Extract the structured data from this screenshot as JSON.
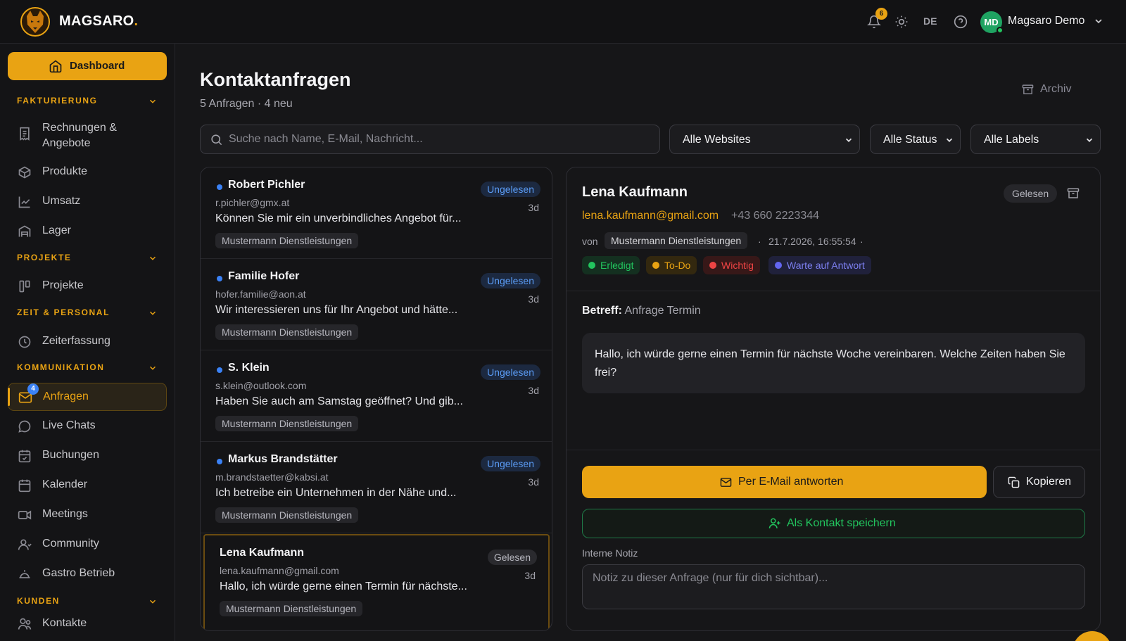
{
  "colors": {
    "accent": "#e9a313",
    "unread": "#3b82f6",
    "success": "#22c55e",
    "background": "#161618"
  },
  "header": {
    "brand": "MAGSARO",
    "brand_dot": ".",
    "notifications_count": "6",
    "language": "DE",
    "avatar_initials": "MD",
    "user_name": "Magsaro Demo"
  },
  "sidebar": {
    "dashboard": "Dashboard",
    "sections": {
      "fakturierung": "FAKTURIERUNG",
      "projekte": "PROJEKTE",
      "zeit": "ZEIT & PERSONAL",
      "kommunikation": "KOMMUNIKATION",
      "kunden": "KUNDEN"
    },
    "items": {
      "rechnungen": "Rechnungen & Angebote",
      "produkte": "Produkte",
      "umsatz": "Umsatz",
      "lager": "Lager",
      "projekte": "Projekte",
      "zeiterfassung": "Zeiterfassung",
      "anfragen": "Anfragen",
      "anfragen_badge": "4",
      "live_chats": "Live Chats",
      "buchungen": "Buchungen",
      "kalender": "Kalender",
      "meetings": "Meetings",
      "community": "Community",
      "gastro": "Gastro Betrieb",
      "kontakte": "Kontakte"
    }
  },
  "main": {
    "title": "Kontaktanfragen",
    "subtitle": "5 Anfragen · 4 neu",
    "archive": "Archiv",
    "search_placeholder": "Suche nach Name, E-Mail, Nachricht...",
    "filters": {
      "websites": "Alle Websites",
      "status": "Alle Status",
      "labels": "Alle Labels"
    }
  },
  "list": [
    {
      "name": "Robert Pichler",
      "email": "r.pichler@gmx.at",
      "message": "Können Sie mir ein unverbindliches Angebot für...",
      "site": "Mustermann Dienstleistungen",
      "status": "Ungelesen",
      "age": "3d"
    },
    {
      "name": "Familie Hofer",
      "email": "hofer.familie@aon.at",
      "message": "Wir interessieren uns für Ihr Angebot und hätte...",
      "site": "Mustermann Dienstleistungen",
      "status": "Ungelesen",
      "age": "3d"
    },
    {
      "name": "S. Klein",
      "email": "s.klein@outlook.com",
      "message": "Haben Sie auch am Samstag geöffnet? Und gib...",
      "site": "Mustermann Dienstleistungen",
      "status": "Ungelesen",
      "age": "3d"
    },
    {
      "name": "Markus Brandstätter",
      "email": "m.brandstaetter@kabsi.at",
      "message": "Ich betreibe ein Unternehmen in der Nähe und...",
      "site": "Mustermann Dienstleistungen",
      "status": "Ungelesen",
      "age": "3d"
    },
    {
      "name": "Lena Kaufmann",
      "email": "lena.kaufmann@gmail.com",
      "message": "Hallo, ich würde gerne einen Termin für nächste...",
      "site": "Mustermann Dienstleistungen",
      "status": "Gelesen",
      "age": "3d"
    }
  ],
  "detail": {
    "name": "Lena Kaufmann",
    "status": "Gelesen",
    "email": "lena.kaufmann@gmail.com",
    "phone": "+43 660 2223344",
    "from_label": "von",
    "site": "Mustermann Dienstleistungen",
    "separator": "·",
    "date": "21.7.2026, 16:55:54",
    "labels": [
      {
        "text": "Erledigt",
        "color": "#22c55e"
      },
      {
        "text": "To-Do",
        "color": "#e9a313"
      },
      {
        "text": "Wichtig",
        "color": "#ef4444"
      },
      {
        "text": "Warte auf Antwort",
        "color": "#6366f1"
      }
    ],
    "subject_label": "Betreff:",
    "subject": "Anfrage Termin",
    "body": "Hallo, ich würde gerne einen Termin für nächste Woche vereinbaren. Welche Zeiten haben Sie frei?",
    "reply_button": "Per E-Mail antworten",
    "copy_button": "Kopieren",
    "save_contact_button": "Als Kontakt speichern",
    "note_label": "Interne Notiz",
    "note_placeholder": "Notiz zu dieser Anfrage (nur für dich sichtbar)..."
  }
}
